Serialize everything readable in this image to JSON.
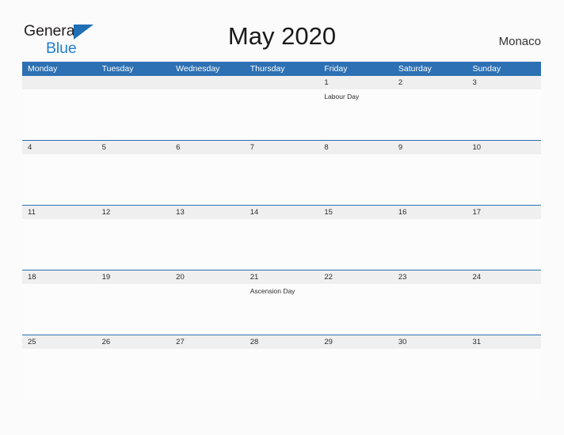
{
  "brand": {
    "name_part1": "General",
    "name_part2": "Blue",
    "triangle_icon": "blue-triangle-icon",
    "color_dark": "#231f20",
    "color_blue": "#1f7fd0"
  },
  "header": {
    "title": "May 2020",
    "country": "Monaco",
    "accent_color": "#2d70b3",
    "date_band_color": "#efefef"
  },
  "weekdays": [
    "Monday",
    "Tuesday",
    "Wednesday",
    "Thursday",
    "Friday",
    "Saturday",
    "Sunday"
  ],
  "weeks": [
    {
      "days": [
        {
          "date": "",
          "event": ""
        },
        {
          "date": "",
          "event": ""
        },
        {
          "date": "",
          "event": ""
        },
        {
          "date": "",
          "event": ""
        },
        {
          "date": "1",
          "event": "Labour Day"
        },
        {
          "date": "2",
          "event": ""
        },
        {
          "date": "3",
          "event": ""
        }
      ]
    },
    {
      "days": [
        {
          "date": "4",
          "event": ""
        },
        {
          "date": "5",
          "event": ""
        },
        {
          "date": "6",
          "event": ""
        },
        {
          "date": "7",
          "event": ""
        },
        {
          "date": "8",
          "event": ""
        },
        {
          "date": "9",
          "event": ""
        },
        {
          "date": "10",
          "event": ""
        }
      ]
    },
    {
      "days": [
        {
          "date": "11",
          "event": ""
        },
        {
          "date": "12",
          "event": ""
        },
        {
          "date": "13",
          "event": ""
        },
        {
          "date": "14",
          "event": ""
        },
        {
          "date": "15",
          "event": ""
        },
        {
          "date": "16",
          "event": ""
        },
        {
          "date": "17",
          "event": ""
        }
      ]
    },
    {
      "days": [
        {
          "date": "18",
          "event": ""
        },
        {
          "date": "19",
          "event": ""
        },
        {
          "date": "20",
          "event": ""
        },
        {
          "date": "21",
          "event": "Ascension Day"
        },
        {
          "date": "22",
          "event": ""
        },
        {
          "date": "23",
          "event": ""
        },
        {
          "date": "24",
          "event": ""
        }
      ]
    },
    {
      "days": [
        {
          "date": "25",
          "event": ""
        },
        {
          "date": "26",
          "event": ""
        },
        {
          "date": "27",
          "event": ""
        },
        {
          "date": "28",
          "event": ""
        },
        {
          "date": "29",
          "event": ""
        },
        {
          "date": "30",
          "event": ""
        },
        {
          "date": "31",
          "event": ""
        }
      ]
    }
  ]
}
